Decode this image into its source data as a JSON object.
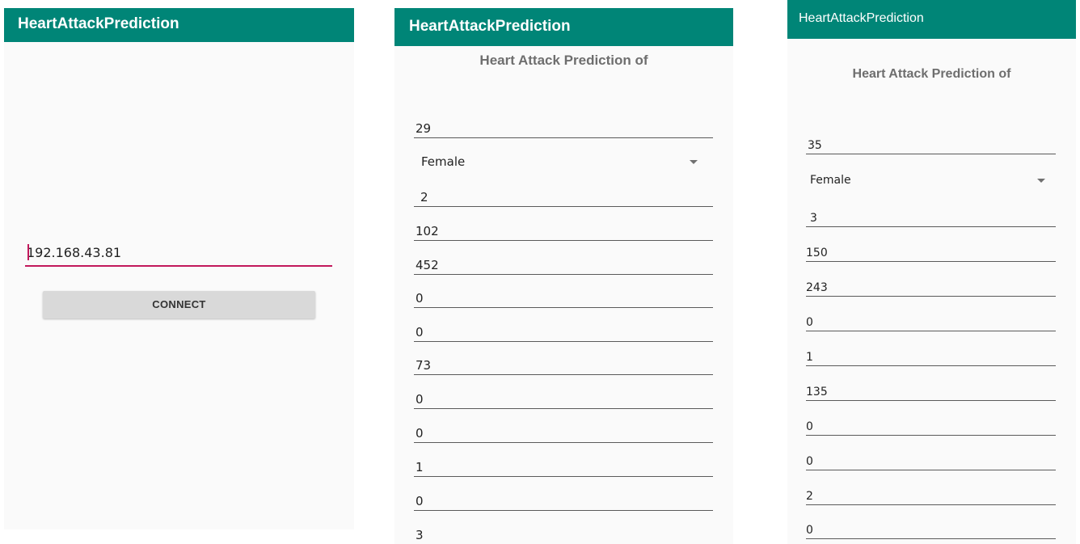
{
  "screen1": {
    "app_title": "HeartAttackPrediction",
    "ip_value": "192.168.43.81",
    "connect_label": "CONNECT"
  },
  "screen2": {
    "app_title": "HeartAttackPrediction",
    "heading": "Heart Attack Prediction of",
    "age": "29",
    "sex_selected": "Female",
    "fields": [
      "2",
      "102",
      "452",
      "0",
      "0",
      "73",
      "0",
      "0",
      "1",
      "0",
      "3"
    ]
  },
  "screen3": {
    "app_title": "HeartAttackPrediction",
    "heading": "Heart Attack Prediction of",
    "age": "35",
    "sex_selected": "Female",
    "fields": [
      "3",
      "150",
      "243",
      "0",
      "1",
      "135",
      "0",
      "0",
      "2",
      "0"
    ]
  },
  "colors": {
    "app_bar": "#008577",
    "accent": "#c2185b",
    "background": "#fafafa"
  },
  "icons": {
    "spinner_arrow": "chevron-down-icon"
  }
}
